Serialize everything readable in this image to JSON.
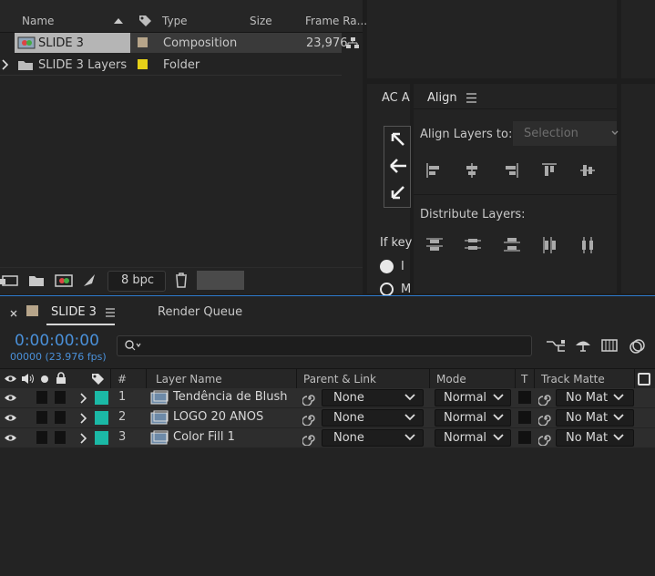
{
  "project": {
    "columns": {
      "name": "Name",
      "type": "Type",
      "size": "Size",
      "frame_rate": "Frame Ra..."
    },
    "items": [
      {
        "name": "SLIDE 3",
        "type": "Composition",
        "frame_rate": "23,976",
        "label_color": "#b7a58a"
      },
      {
        "name": "SLIDE 3 Layers",
        "type": "Folder",
        "frame_rate": "",
        "label_color": "#e6d118"
      }
    ],
    "bit_depth": "8 bpc"
  },
  "ac_panel": {
    "tab": "AC A",
    "keyframe_text": "If key",
    "opt1": "I",
    "opt2": "M"
  },
  "align": {
    "title": "Align",
    "align_layers_to_label": "Align Layers to:",
    "align_layers_to_value": "Selection",
    "distribute_label": "Distribute Layers:"
  },
  "timeline": {
    "tab_name": "SLIDE 3",
    "render_queue": "Render Queue",
    "timecode": "0:00:00:00",
    "frame_info": "00000 (23.976 fps)",
    "headers": {
      "num": "#",
      "layer_name": "Layer Name",
      "parent": "Parent & Link",
      "mode": "Mode",
      "t": "T",
      "track_matte": "Track Matte"
    },
    "layers": [
      {
        "num": "1",
        "name": "Tendência de Blush",
        "parent": "None",
        "mode": "Normal",
        "matte": "No Mat"
      },
      {
        "num": "2",
        "name": "LOGO 20 ANOS",
        "parent": "None",
        "mode": "Normal",
        "matte": "No Mat"
      },
      {
        "num": "3",
        "name": "Color Fill 1",
        "parent": "None",
        "mode": "Normal",
        "matte": "No Mat"
      }
    ],
    "label_color": "#1bb9a6",
    "accent": "#4a90d9"
  }
}
